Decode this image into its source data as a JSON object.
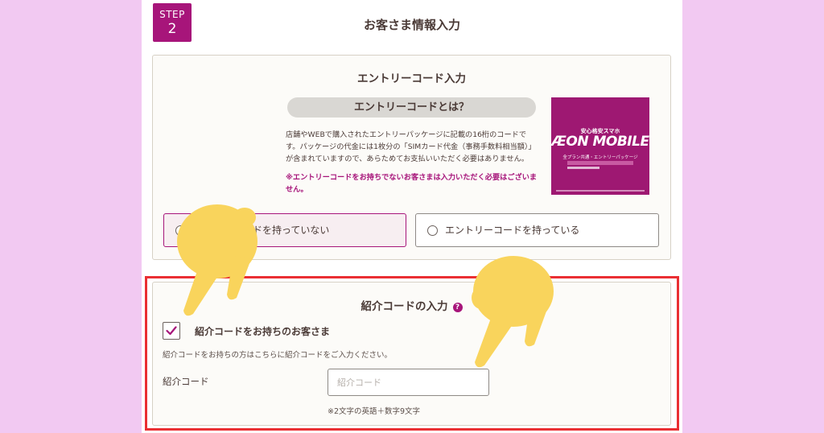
{
  "step": {
    "label": "STEP",
    "number": "2"
  },
  "page_title": "お客さま情報入力",
  "entry": {
    "title": "エントリーコード入力",
    "what_is_button": "エントリーコードとは？",
    "description": "店舗やWEBで購入されたエントリーパッケージに記載の16桁のコードです。パッケージの代金には1枚分の「SIMカード代金（事務手数料相当額）」が含まれていますので、あらためてお支払いいただく必要はありません。",
    "note": "※エントリーコードをお持ちでないお客さまは入力いただく必要はございません。",
    "package": {
      "line1": "安心格安スマホ",
      "brand": "ÆON MOBILE",
      "line3": "全プラン共通・エントリーパッケージ"
    },
    "options": [
      {
        "label": "ドを持っていない",
        "selected": true
      },
      {
        "label": "エントリーコードを持っている",
        "selected": false
      }
    ]
  },
  "referral": {
    "title": "紹介コードの入力",
    "help_icon": "?",
    "checkbox_label": "紹介コードをお持ちのお客さま",
    "checkbox_checked": true,
    "hint": "紹介コードをお持ちの方はこちらに紹介コードをご入力ください。",
    "field_label": "紹介コード",
    "placeholder": "紹介コード",
    "value": "",
    "note": "※2文字の英語＋数字9文字"
  },
  "colors": {
    "background": "#f2c9f2",
    "brand": "#a7157a",
    "highlight_frame": "#ea2f33",
    "pointing_hand": "#f9d45c"
  },
  "icons": [
    "pointing-hand-icon",
    "help-icon",
    "check-icon",
    "radio-icon"
  ]
}
